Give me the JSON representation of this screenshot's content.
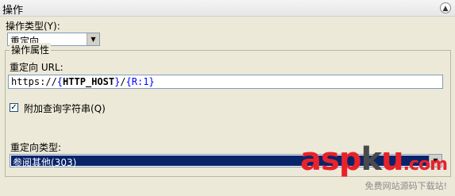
{
  "header": {
    "title": "操作"
  },
  "action_type": {
    "label": "操作类型(Y):",
    "value": "重定向"
  },
  "properties": {
    "legend": "操作属性",
    "url_label": "重定向 URL:",
    "url_parts": [
      "https://",
      "{",
      "HTTP_HOST",
      "}",
      "/",
      "{R:1}"
    ],
    "append_query_label": "附加查询字符串(Q)",
    "append_query_checked": true,
    "redirect_type_label": "重定向类型:",
    "redirect_type_value": "参阅其他(303)"
  },
  "watermark": {
    "logo_parts": [
      "asp",
      "k",
      "u",
      ".com"
    ],
    "subtitle": "免费网站源码下载站!"
  }
}
